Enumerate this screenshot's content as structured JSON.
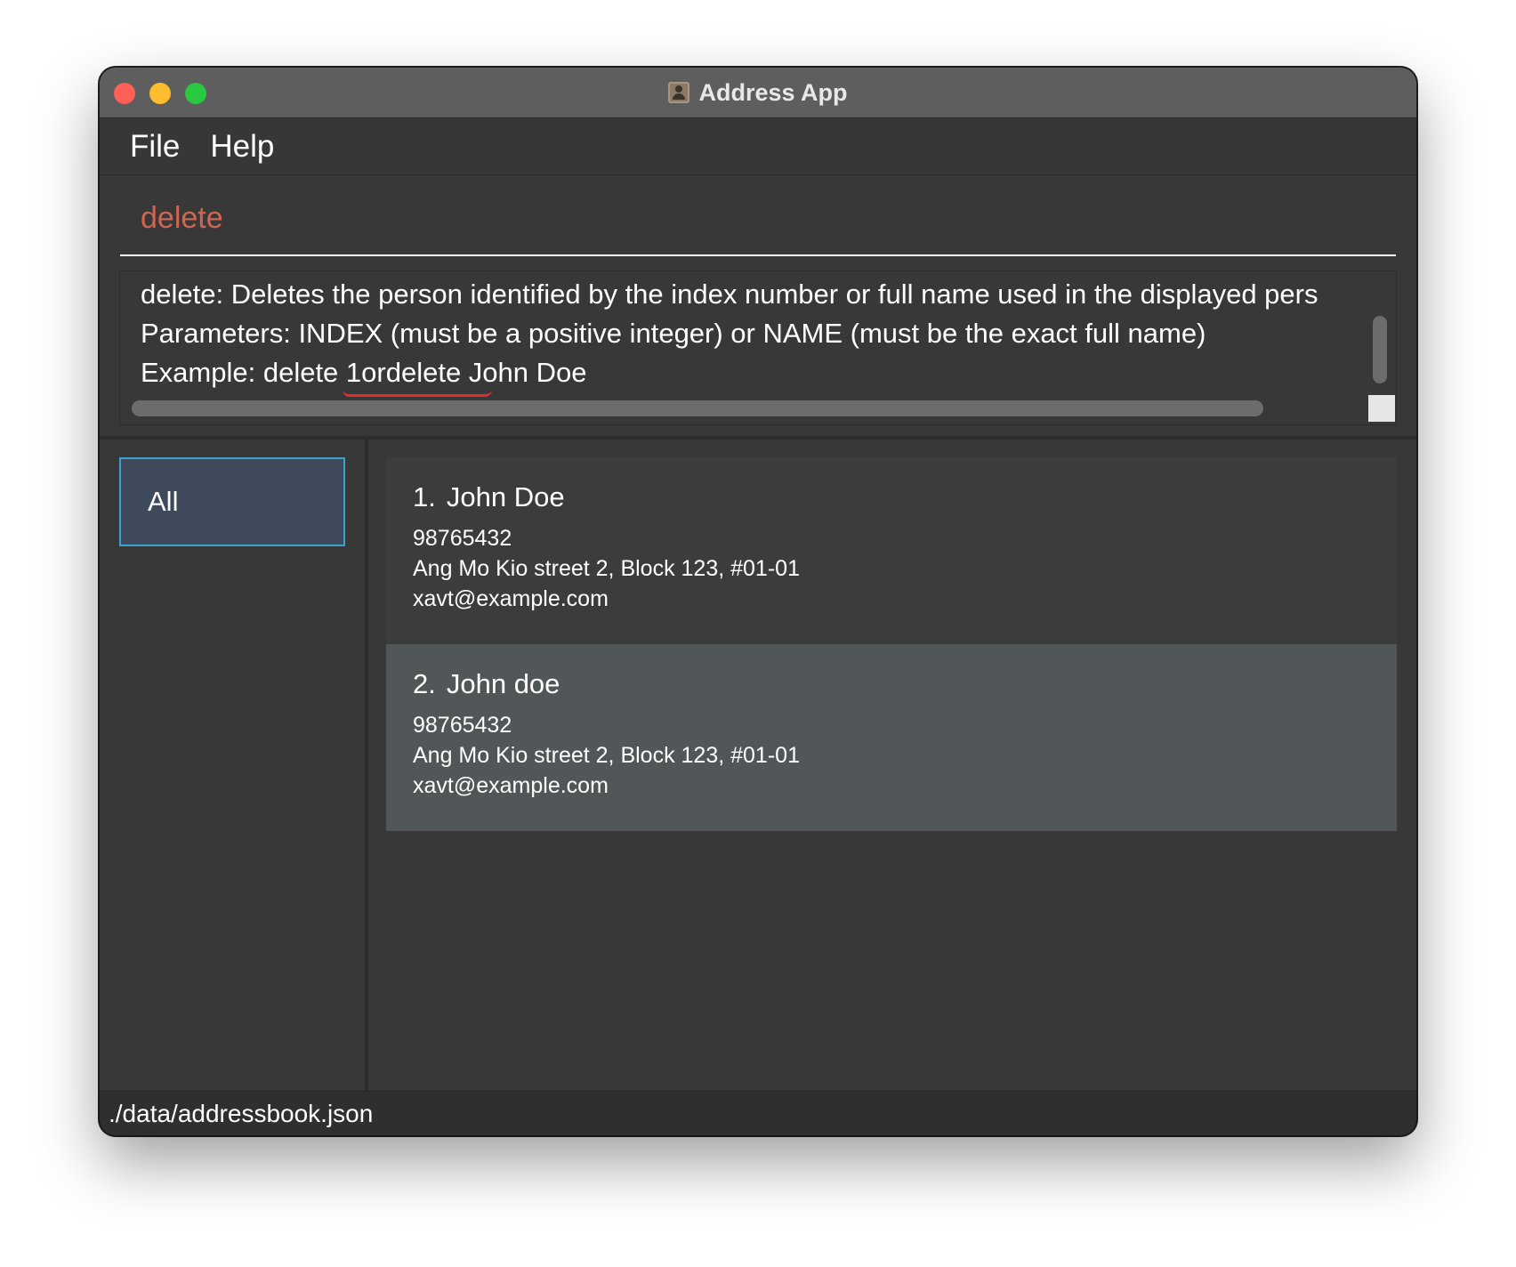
{
  "window": {
    "title": "Address App",
    "app_icon": "address-book-icon"
  },
  "menu": {
    "file_label": "File",
    "help_label": "Help"
  },
  "command": {
    "value": "delete"
  },
  "result": {
    "text": "delete: Deletes the person identified by the index number or full name used in the displayed pers\nParameters: INDEX (must be a positive integer) or NAME (must be the exact full name)\nExample: delete 1ordelete John Doe"
  },
  "sidebar": {
    "all_label": "All"
  },
  "persons": [
    {
      "index": "1.",
      "name": "John Doe",
      "phone": "98765432",
      "address": "Ang Mo Kio street 2, Block 123, #01-01",
      "email": "xavt@example.com"
    },
    {
      "index": "2.",
      "name": "John doe",
      "phone": "98765432",
      "address": "Ang Mo Kio street 2, Block 123, #01-01",
      "email": "xavt@example.com"
    }
  ],
  "status": {
    "path": "./data/addressbook.json"
  },
  "colors": {
    "command_text": "#d06651",
    "selected_border": "#3aa0cf",
    "window_bg": "#383838"
  }
}
